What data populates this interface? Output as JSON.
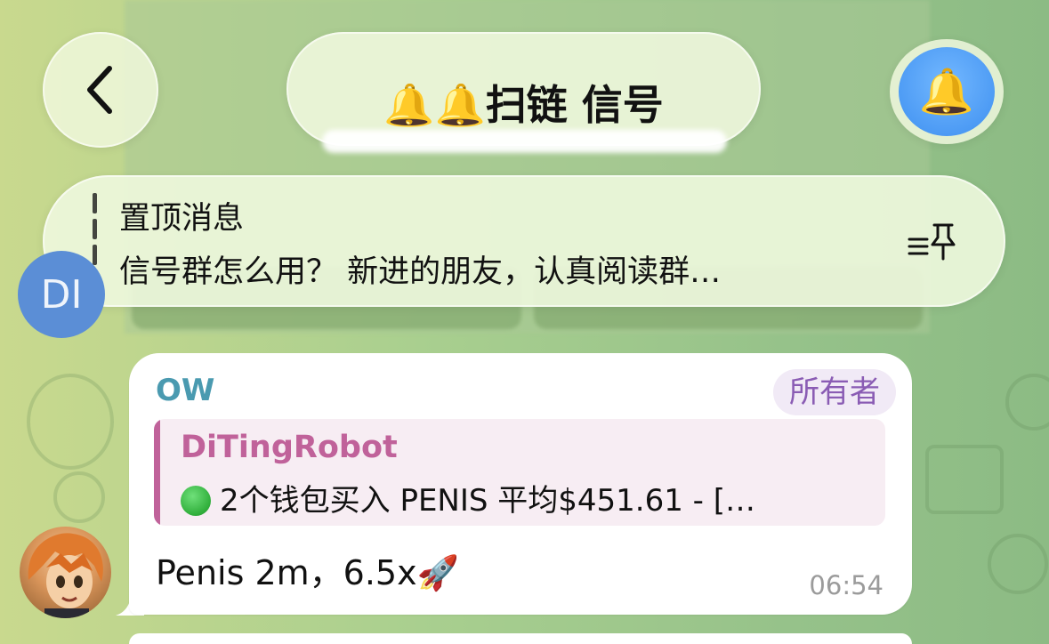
{
  "header": {
    "back_icon": "chevron-left-icon",
    "title": "🔔🔔扫链 信号",
    "avatar_emoji": "🔔"
  },
  "pinned": {
    "label": "置顶消息",
    "text": "信号群怎么用？ 新进的朋友，认真阅读群…",
    "list_icon": "pinned-list-icon"
  },
  "partial_avatar": {
    "initials": "DI"
  },
  "message": {
    "sender": "OW",
    "badge": "所有者",
    "reply": {
      "author": "DiTingRobot",
      "emoji": "green-circle",
      "text": "2个钱包买入 PENIS 平均$451.61 - […"
    },
    "body": "Penis 2m，6.5x🚀",
    "time": "06:54"
  },
  "colors": {
    "sender_name": "#4a9ab0",
    "badge_text": "#8a5cb4",
    "badge_bg": "#f1eaf6",
    "reply_accent": "#c0629a",
    "reply_bg": "#f7edf3",
    "avatar_blue": "#3d8ff0"
  }
}
